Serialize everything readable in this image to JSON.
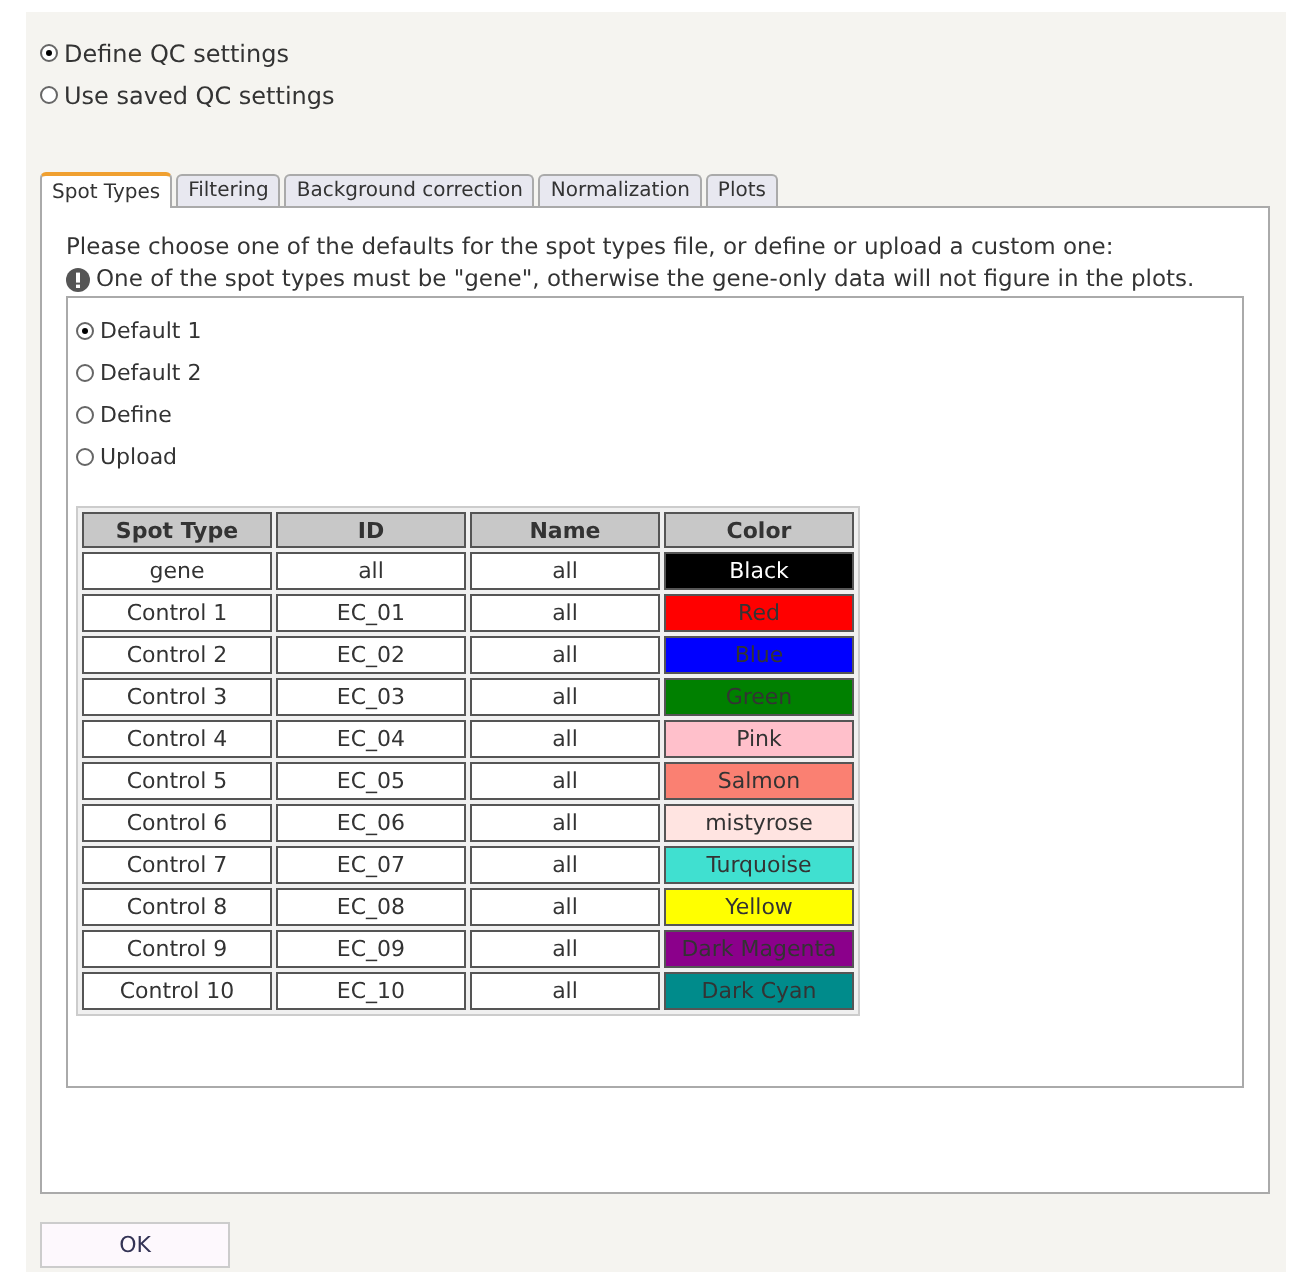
{
  "mode_options": [
    {
      "label": "Define QC settings",
      "selected": true
    },
    {
      "label": "Use saved QC settings",
      "selected": false
    }
  ],
  "tabs": [
    {
      "label": "Spot Types",
      "selected": true
    },
    {
      "label": "Filtering",
      "selected": false
    },
    {
      "label": "Background correction",
      "selected": false
    },
    {
      "label": "Normalization",
      "selected": false
    },
    {
      "label": "Plots",
      "selected": false
    }
  ],
  "instruction": "Please choose one of the defaults for the spot types file, or define or upload a custom one:",
  "warning": "One of the spot types must be \"gene\", otherwise the gene-only data will not figure in the plots.",
  "source_options": [
    {
      "label": "Default 1",
      "selected": true
    },
    {
      "label": "Default 2",
      "selected": false
    },
    {
      "label": "Define",
      "selected": false
    },
    {
      "label": "Upload",
      "selected": false
    }
  ],
  "table": {
    "columns": [
      "Spot Type",
      "ID",
      "Name",
      "Color"
    ],
    "rows": [
      {
        "spot_type": "gene",
        "id": "all",
        "name": "all",
        "color_name": "Black",
        "color": "#000000"
      },
      {
        "spot_type": "Control 1",
        "id": "EC_01",
        "name": "all",
        "color_name": "Red",
        "color": "#ff0000"
      },
      {
        "spot_type": "Control 2",
        "id": "EC_02",
        "name": "all",
        "color_name": "Blue",
        "color": "#0000ff"
      },
      {
        "spot_type": "Control 3",
        "id": "EC_03",
        "name": "all",
        "color_name": "Green",
        "color": "#008000"
      },
      {
        "spot_type": "Control 4",
        "id": "EC_04",
        "name": "all",
        "color_name": "Pink",
        "color": "#ffc0cb"
      },
      {
        "spot_type": "Control 5",
        "id": "EC_05",
        "name": "all",
        "color_name": "Salmon",
        "color": "#fa8072"
      },
      {
        "spot_type": "Control 6",
        "id": "EC_06",
        "name": "all",
        "color_name": "mistyrose",
        "color": "#ffe4e1"
      },
      {
        "spot_type": "Control 7",
        "id": "EC_07",
        "name": "all",
        "color_name": "Turquoise",
        "color": "#40e0d0"
      },
      {
        "spot_type": "Control 8",
        "id": "EC_08",
        "name": "all",
        "color_name": "Yellow",
        "color": "#ffff00"
      },
      {
        "spot_type": "Control 9",
        "id": "EC_09",
        "name": "all",
        "color_name": "Dark Magenta",
        "color": "#8b008b"
      },
      {
        "spot_type": "Control 10",
        "id": "EC_10",
        "name": "all",
        "color_name": "Dark Cyan",
        "color": "#008b8b"
      }
    ]
  },
  "ok_button": "OK"
}
